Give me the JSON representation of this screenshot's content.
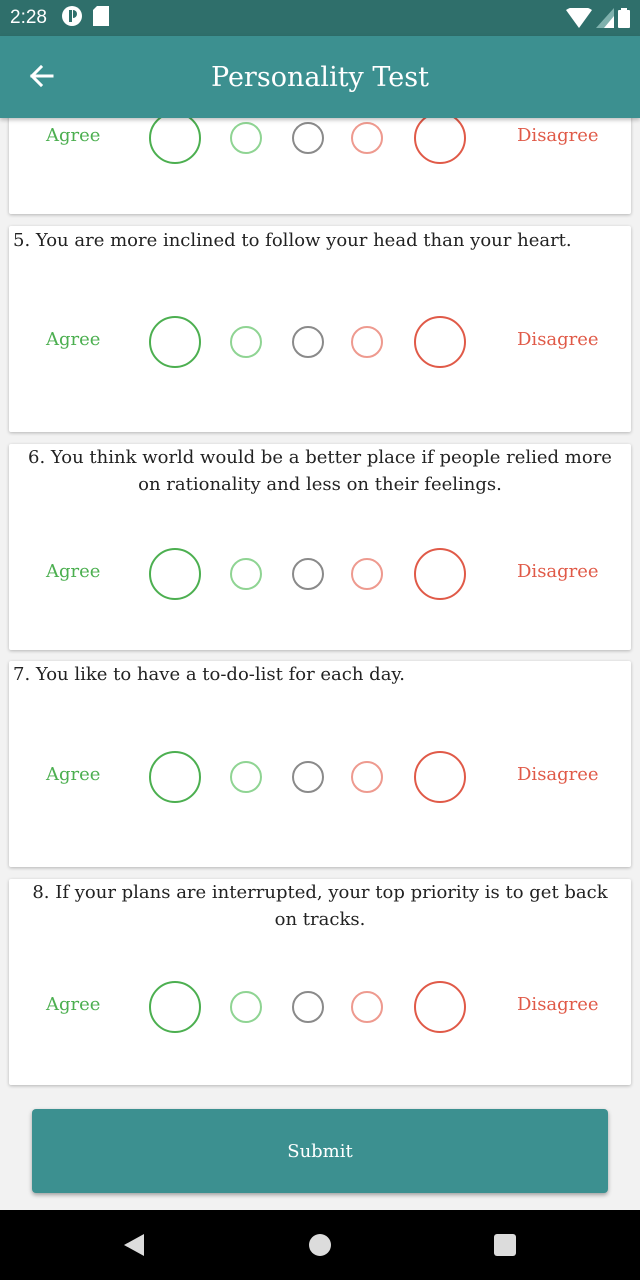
{
  "status_bar": {
    "time": "2:28"
  },
  "app_bar": {
    "title": "Personality Test",
    "back_icon": "arrow-back-icon"
  },
  "scale": {
    "agree_label": "Agree",
    "disagree_label": "Disagree"
  },
  "questions": [
    {
      "text": ""
    },
    {
      "text": "5. You are more inclined to follow your head than your heart."
    },
    {
      "text": "6. You think world would be a better place if people relied more on rationality and less on their feelings."
    },
    {
      "text": "7. You like to have a to-do-list for each day."
    },
    {
      "text": "8. If your plans are interrupted, your top priority is to get back on tracks."
    }
  ],
  "submit": {
    "label": "Submit"
  },
  "colors": {
    "primary": "#3c9090",
    "status": "#2f6f6b",
    "agree": "#4caf50",
    "disagree": "#e05a48"
  }
}
